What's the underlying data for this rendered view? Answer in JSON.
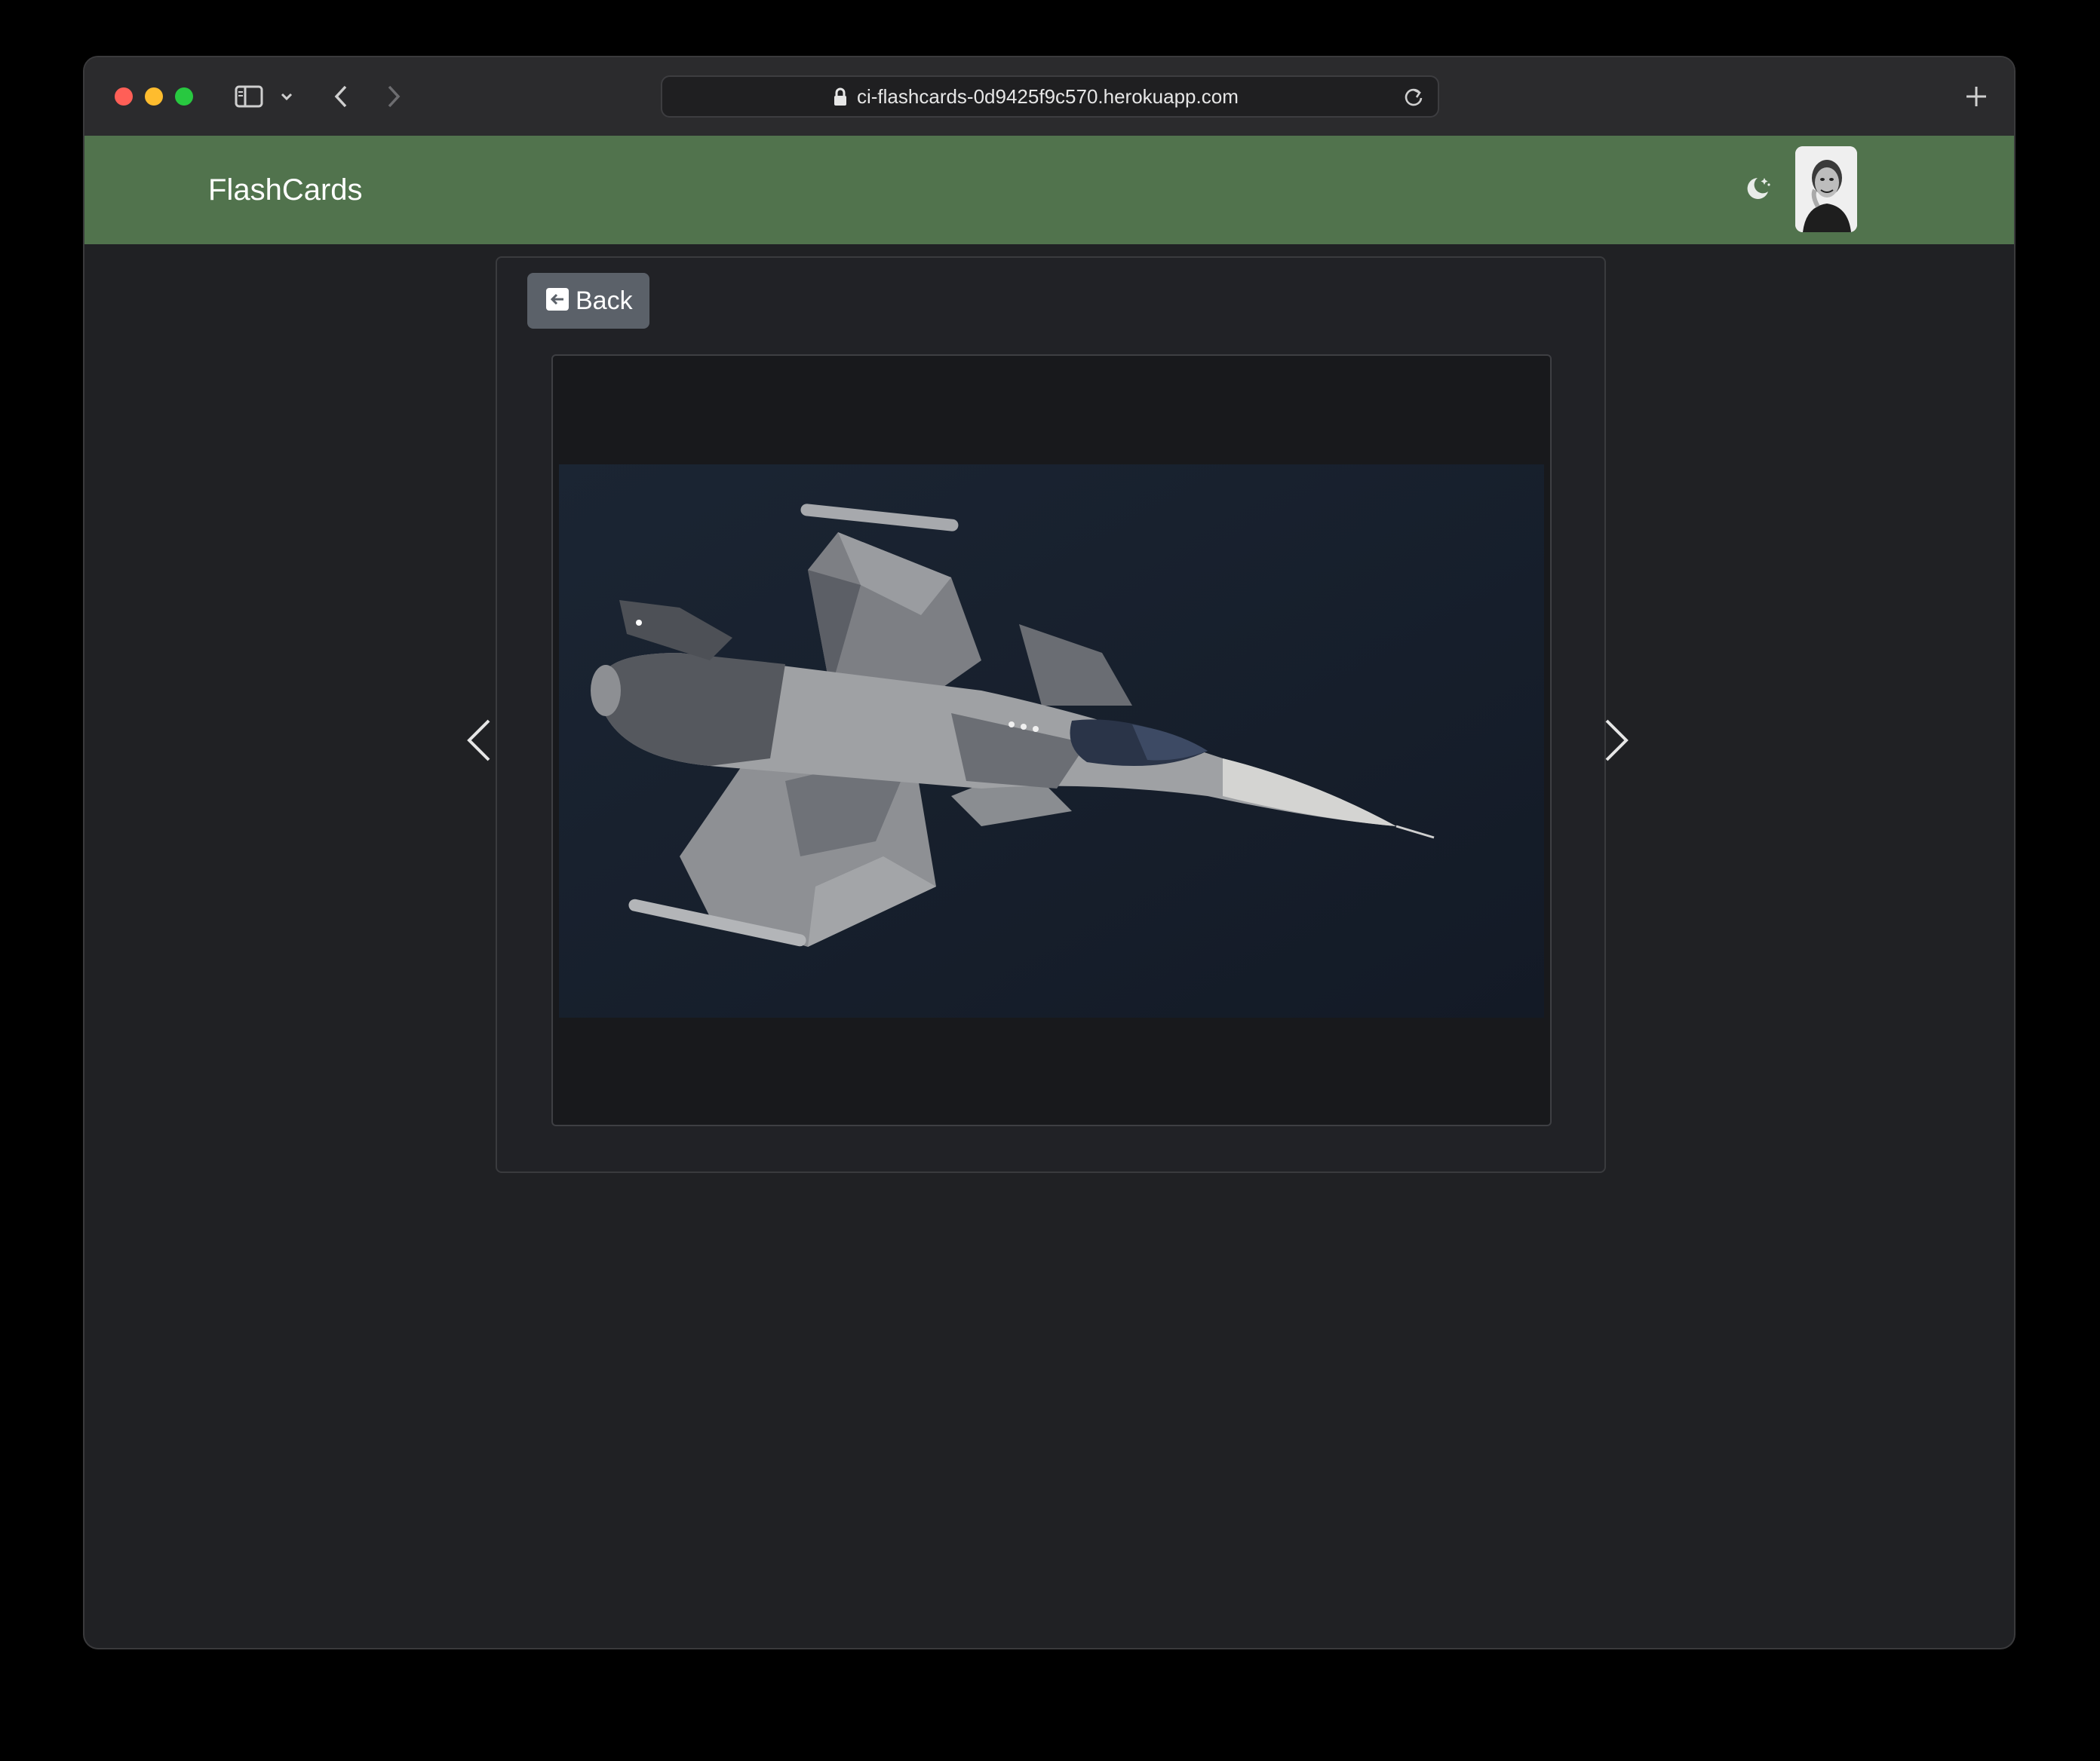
{
  "browser": {
    "url": "ci-flashcards-0d9425f9c570.herokuapp.com",
    "icons": {
      "sidebar": "sidebar-toggle-icon",
      "chevron": "chevron-down-icon",
      "back": "back-arrow-icon",
      "forward": "forward-arrow-icon",
      "lock": "lock-icon",
      "reload": "reload-icon",
      "new_tab": "plus-icon"
    }
  },
  "navbar": {
    "brand": "FlashCards",
    "theme_icon": "moon-stars-icon",
    "background": "#51734d"
  },
  "card": {
    "back_label": "Back",
    "back_icon": "arrow-left-square-icon",
    "image_subject": "fighter-jet-photo"
  },
  "carousel": {
    "prev_icon": "chevron-left-icon",
    "next_icon": "chevron-right-icon"
  }
}
